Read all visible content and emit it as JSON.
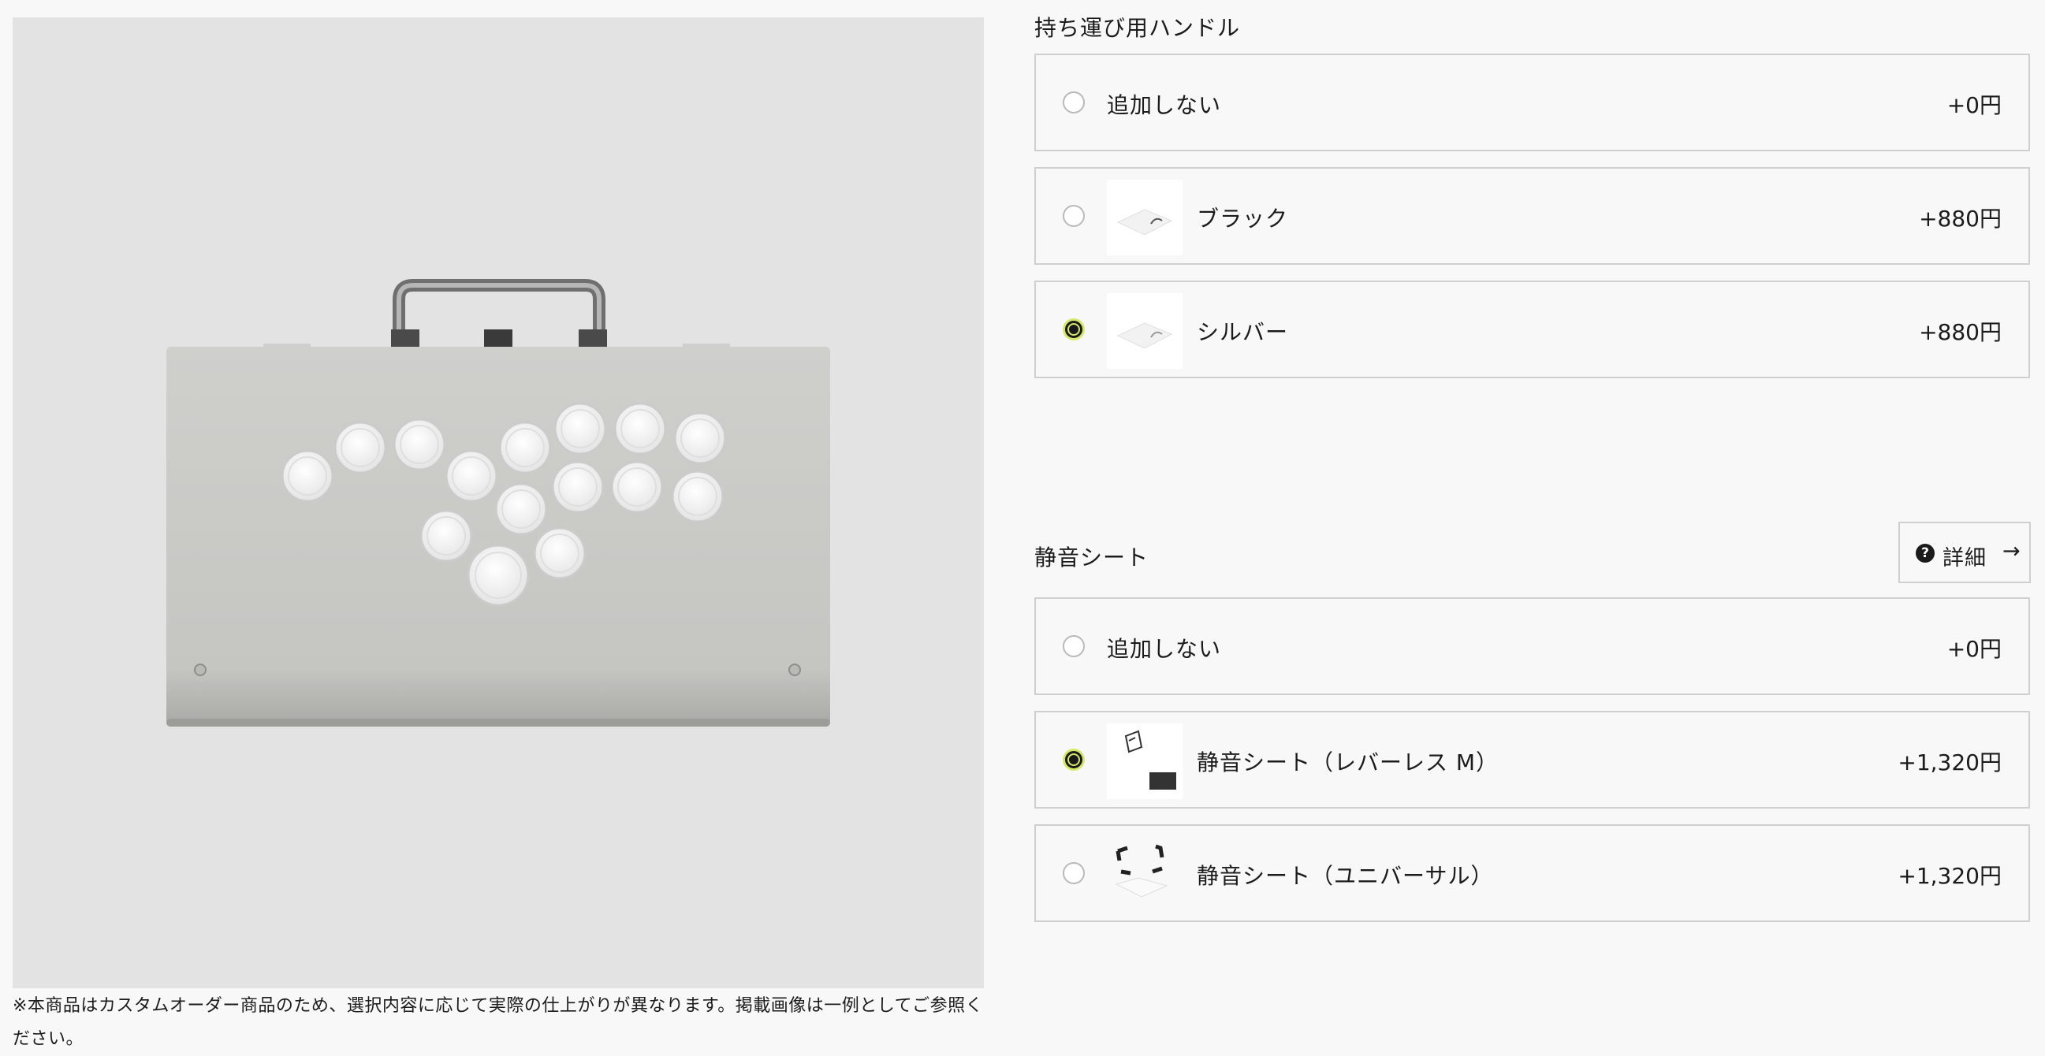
{
  "product": {
    "image_alt": "product-arcade-controller-image",
    "disclaimer": "※本商品はカスタムオーダー商品のため、選択内容に応じて実際の仕上がりが異なります。掲載画像は一例としてご参照ください。"
  },
  "handle_section": {
    "title": "持ち運び用ハンドル",
    "options": [
      {
        "label": "追加しない",
        "price": "+0円",
        "selected": false,
        "has_thumb": false
      },
      {
        "label": "ブラック",
        "price": "+880円",
        "selected": false,
        "has_thumb": true
      },
      {
        "label": "シルバー",
        "price": "+880円",
        "selected": true,
        "has_thumb": true
      }
    ]
  },
  "silent_sheet_section": {
    "title": "静音シート",
    "detail_button": {
      "label": "詳細",
      "icon": "question-circle-icon",
      "arrow": "→"
    },
    "options": [
      {
        "label": "追加しない",
        "price": "+0円",
        "selected": false,
        "has_thumb": false
      },
      {
        "label": "静音シート（レバーレス M）",
        "price": "+1,320円",
        "selected": true,
        "has_thumb": true
      },
      {
        "label": "静音シート（ユニバーサル）",
        "price": "+1,320円",
        "selected": false,
        "has_thumb": true
      }
    ]
  },
  "colors": {
    "accent_radio": "#d6e86a",
    "border": "#cfcfcf",
    "image_bg": "#e3e3e3"
  }
}
